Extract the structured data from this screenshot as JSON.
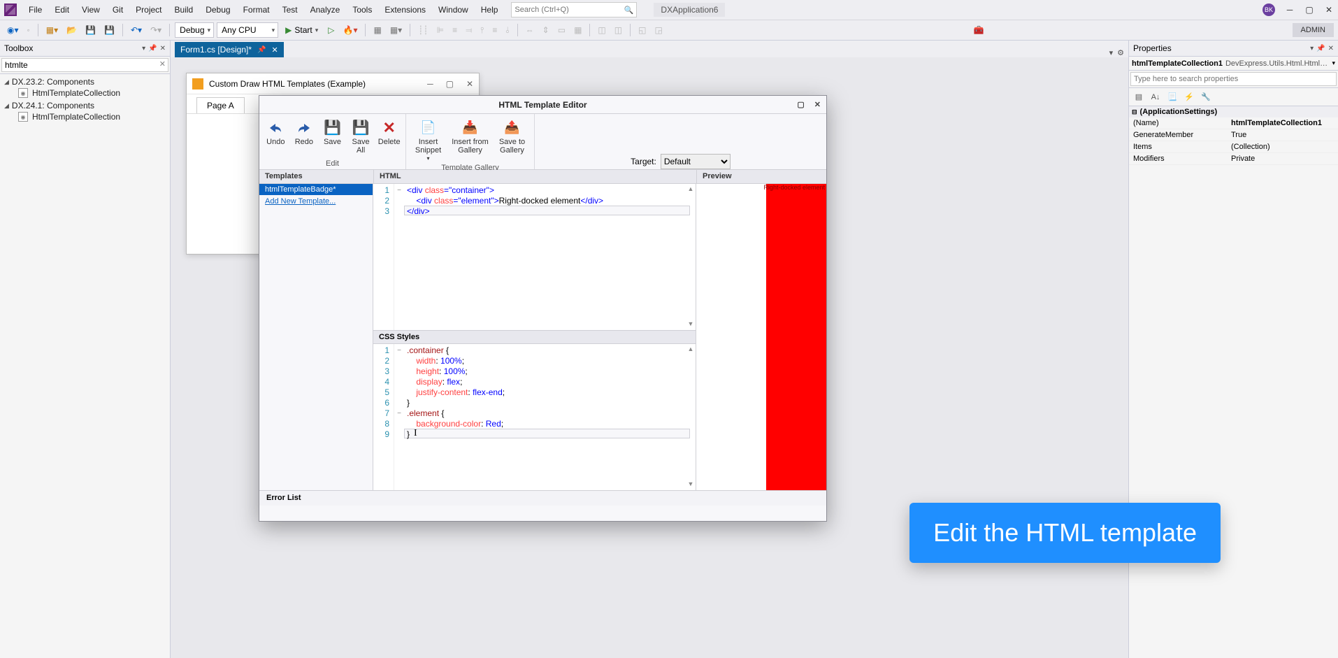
{
  "menubar": {
    "items": [
      "File",
      "Edit",
      "View",
      "Git",
      "Project",
      "Build",
      "Debug",
      "Format",
      "Test",
      "Analyze",
      "Tools",
      "Extensions",
      "Window",
      "Help"
    ],
    "search_placeholder": "Search (Ctrl+Q)",
    "app_label": "DXApplication6",
    "avatar_initials": "BK",
    "admin_label": "ADMIN"
  },
  "toolbar": {
    "config": "Debug",
    "platform": "Any CPU",
    "start_label": "Start"
  },
  "toolbox": {
    "title": "Toolbox",
    "search_value": "htmlte",
    "groups": [
      {
        "header": "DX.23.2: Components",
        "items": [
          "HtmlTemplateCollection"
        ]
      },
      {
        "header": "DX.24.1: Components",
        "items": [
          "HtmlTemplateCollection"
        ]
      }
    ]
  },
  "doc_tab": {
    "name": "Form1.cs [Design]*"
  },
  "form_window": {
    "title": "Custom Draw HTML Templates (Example)",
    "tab": "Page A"
  },
  "editor": {
    "title": "HTML Template Editor",
    "ribbon": {
      "undo": "Undo",
      "redo": "Redo",
      "save": "Save",
      "saveall": "Save All",
      "delete": "Delete",
      "insert_snippet": "Insert Snippet",
      "insert_from_gallery": "Insert from Gallery",
      "save_to_gallery": "Save to Gallery",
      "group_edit": "Edit",
      "group_gallery": "Template Gallery",
      "target_label": "Target:",
      "target_value": "Default",
      "preview_group": "Preview"
    },
    "templates_header": "Templates",
    "template_items": [
      "htmlTemplateBadge*"
    ],
    "add_template": "Add New Template...",
    "html_header": "HTML",
    "css_header": "CSS Styles",
    "preview_header": "Preview",
    "error_header": "Error List",
    "html_code": {
      "l1_open": "<div ",
      "l1_attr": "class",
      "l1_eq": "=",
      "l1_val": "\"container\"",
      "l1_close": ">",
      "l2_indent": "    ",
      "l2_open": "<div ",
      "l2_attr": "class",
      "l2_eq": "=",
      "l2_val": "\"element\"",
      "l2_close": ">",
      "l2_text": "Right-docked element",
      "l2_end": "</div>",
      "l3": "</div>"
    },
    "css_code": {
      "l1": ".container",
      "l1b": " {",
      "l2p": "width",
      "l2v": "100%",
      "l3p": "height",
      "l3v": "100%",
      "l4p": "display",
      "l4v": "flex",
      "l5p": "justify-content",
      "l5v": "flex-end",
      "l6": "}",
      "l7": ".element",
      "l7b": " {",
      "l8p": "background-color",
      "l8v": "Red",
      "l9": "}"
    },
    "preview_label": "Right-docked element"
  },
  "properties": {
    "title": "Properties",
    "object_name": "htmlTemplateCollection1",
    "object_type": "DevExpress.Utils.Html.HtmlTemplate",
    "search_placeholder": "Type here to search properties",
    "category": "(ApplicationSettings)",
    "rows": [
      {
        "name": "(Name)",
        "value": "htmlTemplateCollection1"
      },
      {
        "name": "GenerateMember",
        "value": "True"
      },
      {
        "name": "Items",
        "value": "(Collection)"
      },
      {
        "name": "Modifiers",
        "value": "Private"
      }
    ]
  },
  "callout": {
    "text": "Edit the HTML template"
  }
}
